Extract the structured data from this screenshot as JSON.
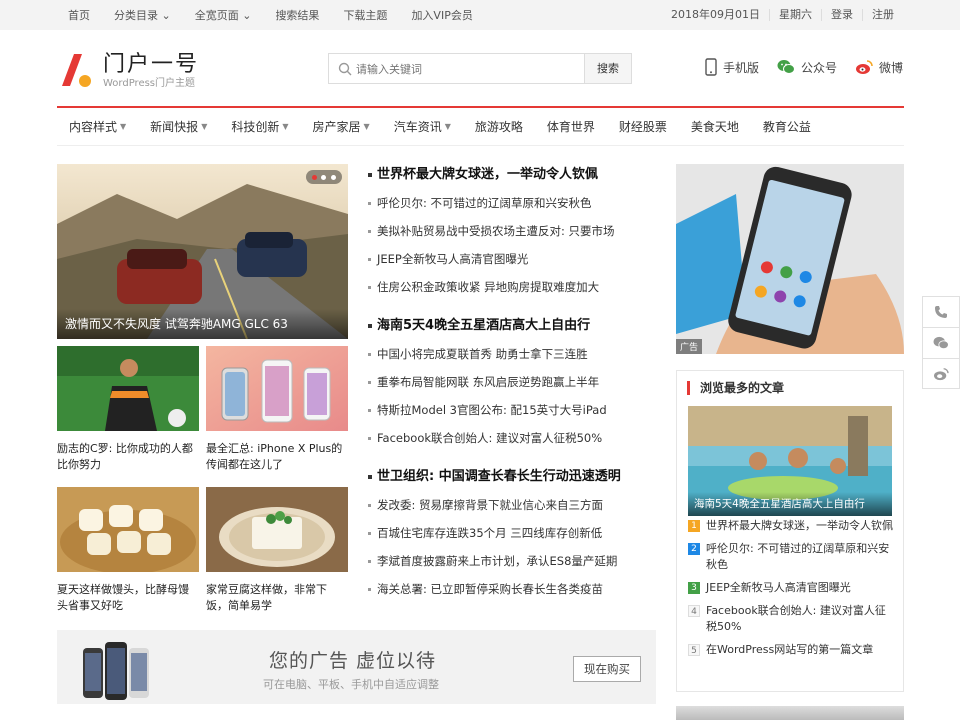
{
  "topbar": {
    "nav": [
      "首页",
      "分类目录 ⌄",
      "全宽页面 ⌄",
      "搜索结果",
      "下载主题",
      "加入VIP会员"
    ],
    "date": "2018年09月01日",
    "weekday": "星期六",
    "login": "登录",
    "register": "注册"
  },
  "logo": {
    "title": "门户一号",
    "subtitle": "WordPress门户主题"
  },
  "search": {
    "placeholder": "请输入关键词",
    "button": "搜索"
  },
  "header_links": {
    "mobile": "手机版",
    "wechat": "公众号",
    "weibo": "微博"
  },
  "mainnav": [
    {
      "label": "内容样式",
      "dropdown": true
    },
    {
      "label": "新闻快报",
      "dropdown": true
    },
    {
      "label": "科技创新",
      "dropdown": true
    },
    {
      "label": "房产家居",
      "dropdown": true
    },
    {
      "label": "汽车资讯",
      "dropdown": true
    },
    {
      "label": "旅游攻略",
      "dropdown": false
    },
    {
      "label": "体育世界",
      "dropdown": false
    },
    {
      "label": "财经股票",
      "dropdown": false
    },
    {
      "label": "美食天地",
      "dropdown": false
    },
    {
      "label": "教育公益",
      "dropdown": false
    }
  ],
  "slider": {
    "caption": "激情而又不失风度 试驾奔驰AMG GLC 63"
  },
  "thumbs": [
    {
      "title": "励志的C罗: 比你成功的人都比你努力"
    },
    {
      "title": "最全汇总: iPhone X Plus的传闻都在这儿了"
    },
    {
      "title": "夏天这样做馒头，比酵母馒头省事又好吃"
    },
    {
      "title": "家常豆腐这样做，非常下饭，简单易学"
    }
  ],
  "news_groups": [
    {
      "headline": "世界杯最大牌女球迷，一举动令人钦佩",
      "items": [
        "呼伦贝尔: 不可错过的辽阔草原和兴安秋色",
        "美拟补贴贸易战中受损农场主遭反对: 只要市场",
        "JEEP全新牧马人高清官图曝光",
        "住房公积金政策收紧 异地购房提取难度加大"
      ]
    },
    {
      "headline": "海南5天4晚全五星酒店高大上自由行",
      "items": [
        "中国小将完成夏联首秀 助勇士拿下三连胜",
        "重拳布局智能网联 东风启辰逆势跑赢上半年",
        "特斯拉Model 3官图公布: 配15英寸大号iPad",
        "Facebook联合创始人: 建议对富人征税50%"
      ]
    },
    {
      "headline": "世卫组织: 中国调查长春长生行动迅速透明",
      "items": [
        "发改委: 贸易摩擦背景下就业信心来自三方面",
        "百城住宅库存连跌35个月 三四线库存创新低",
        "李斌首度披露蔚来上市计划，承认ES8量产延期",
        "海关总署: 已立即暂停采购长春长生各类疫苗"
      ]
    }
  ],
  "ad_banner": {
    "title": "您的广告 虚位以待",
    "subtitle": "可在电脑、平板、手机中自适应调整",
    "button": "现在购买"
  },
  "side_ad": {
    "tag": "广告"
  },
  "hot": {
    "title": "浏览最多的文章",
    "pic_caption": "海南5天4晚全五星酒店高大上自由行",
    "items": [
      {
        "num": "1",
        "text": "世界杯最大牌女球迷，一举动令人钦佩",
        "color": "#f5a623"
      },
      {
        "num": "2",
        "text": "呼伦贝尔: 不可错过的辽阔草原和兴安秋色",
        "color": "#1e88e5"
      },
      {
        "num": "3",
        "text": "JEEP全新牧马人高清官图曝光",
        "color": "#43a047"
      },
      {
        "num": "4",
        "text": "Facebook联合创始人: 建议对富人征税50%",
        "color": ""
      },
      {
        "num": "5",
        "text": "在WordPress网站写的第一篇文章",
        "color": ""
      }
    ]
  },
  "colors": {
    "accent": "#e53935"
  }
}
